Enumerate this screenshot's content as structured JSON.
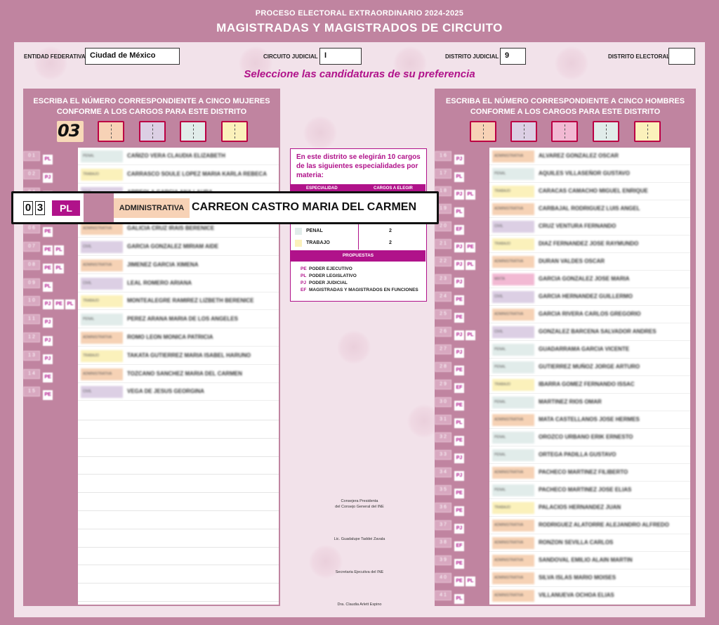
{
  "header": {
    "process": "PROCESO ELECTORAL EXTRAORDINARIO 2024-2025",
    "title": "MAGISTRADAS Y MAGISTRADOS DE CIRCUITO"
  },
  "fields": {
    "entidad_label": "ENTIDAD FEDERATIVA",
    "entidad_value": "Ciudad de México",
    "circuito_label": "CIRCUITO JUDICIAL",
    "circuito_value": "I",
    "distrito_judicial_label": "DISTRITO JUDICIAL",
    "distrito_judicial_value": "9",
    "distrito_electoral_label": "DISTRITO ELECTORAL",
    "distrito_electoral_value": ""
  },
  "instruction": "Seleccione las candidaturas de su preferencia",
  "left_panel": {
    "title_line1": "ESCRIBA EL NÚMERO CORRESPONDIENTE A CINCO MUJERES",
    "title_line2": "CONFORME A LOS CARGOS PARA ESTE DISTRITO",
    "written_slot": "03",
    "candidates": [
      {
        "num": "0 1",
        "tags": [
          "PL"
        ],
        "spec": "PENAL",
        "name": "CAÑIZO VERA CLAUDIA ELIZABETH"
      },
      {
        "num": "0 2",
        "tags": [
          "PJ"
        ],
        "spec": "TRABAJO",
        "name": "CARRASCO SOULE LOPEZ MARIA KARLA REBECA"
      },
      {
        "num": "0 4",
        "tags": [
          "PE"
        ],
        "spec": "CIVIL",
        "name": "ARREOLA GARCIA ANA LAURA"
      },
      {
        "num": "0 5",
        "tags": [
          "PE",
          "PL"
        ],
        "spec": "CIVIL",
        "name": "CONDE NADER SONIA MARIBEL"
      },
      {
        "num": "0 6",
        "tags": [
          "PE"
        ],
        "spec": "ADMINISTRATIVA",
        "name": "GALICIA CRUZ IRAIS BERENICE"
      },
      {
        "num": "0 7",
        "tags": [
          "PE",
          "PL"
        ],
        "spec": "CIVIL",
        "name": "GARCIA GONZALEZ MIRIAM AIDE"
      },
      {
        "num": "0 8",
        "tags": [
          "PE",
          "PL"
        ],
        "spec": "ADMINISTRATIVA",
        "name": "JIMENEZ GARCIA XIMENA"
      },
      {
        "num": "0 9",
        "tags": [
          "PL"
        ],
        "spec": "CIVIL",
        "name": "LEAL ROMERO ARIANA"
      },
      {
        "num": "1 0",
        "tags": [
          "PJ",
          "PE",
          "PL"
        ],
        "spec": "TRABAJO",
        "name": "MONTEALEGRE RAMIREZ LIZBETH BERENICE"
      },
      {
        "num": "1 1",
        "tags": [
          "PJ"
        ],
        "spec": "PENAL",
        "name": "PEREZ ARANA MARIA DE LOS ANGELES"
      },
      {
        "num": "1 2",
        "tags": [
          "PJ"
        ],
        "spec": "ADMINISTRATIVA",
        "name": "ROMO LEON MONICA PATRICIA"
      },
      {
        "num": "1 3",
        "tags": [
          "PJ"
        ],
        "spec": "TRABAJO",
        "name": "TAKATA GUTIERREZ MARIA ISABEL HARUNO"
      },
      {
        "num": "1 4",
        "tags": [
          "PE"
        ],
        "spec": "ADMINISTRATIVA",
        "name": "TOZCANO SANCHEZ MARIA DEL CARMEN"
      },
      {
        "num": "1 5",
        "tags": [
          "PE"
        ],
        "spec": "CIVIL",
        "name": "VEGA DE JESUS GEORGINA"
      }
    ]
  },
  "right_panel": {
    "title_line1": "ESCRIBA EL NÚMERO CORRESPONDIENTE A CINCO HOMBRES",
    "title_line2": "CONFORME A LOS CARGOS PARA ESTE DISTRITO",
    "candidates": [
      {
        "num": "1 6",
        "tags": [
          "PJ"
        ],
        "spec": "ADMINISTRATIVA",
        "name": "ALVAREZ GONZALEZ OSCAR"
      },
      {
        "num": "1 7",
        "tags": [
          "PL"
        ],
        "spec": "PENAL",
        "name": "AQUILES VILLASEÑOR GUSTAVO"
      },
      {
        "num": "1 8",
        "tags": [
          "PJ",
          "PL"
        ],
        "spec": "TRABAJO",
        "name": "CARACAS CAMACHO MIGUEL ENRIQUE"
      },
      {
        "num": "1 9",
        "tags": [
          "PL"
        ],
        "spec": "ADMINISTRATIVA",
        "name": "CARBAJAL RODRIGUEZ LUIS ANGEL"
      },
      {
        "num": "2 0",
        "tags": [
          "EF"
        ],
        "spec": "CIVIL",
        "name": "CRUZ VENTURA FERNANDO"
      },
      {
        "num": "2 1",
        "tags": [
          "PJ",
          "PE"
        ],
        "spec": "TRABAJO",
        "name": "DIAZ FERNANDEZ JOSE RAYMUNDO"
      },
      {
        "num": "2 2",
        "tags": [
          "PJ",
          "PL"
        ],
        "spec": "ADMINISTRATIVA",
        "name": "DURAN VALDES OSCAR"
      },
      {
        "num": "2 3",
        "tags": [
          "PJ"
        ],
        "spec": "MIXTA",
        "name": "GARCIA GONZALEZ JOSE MARIA"
      },
      {
        "num": "2 4",
        "tags": [
          "PE"
        ],
        "spec": "CIVIL",
        "name": "GARCIA HERNANDEZ GUILLERMO"
      },
      {
        "num": "2 5",
        "tags": [
          "PE"
        ],
        "spec": "ADMINISTRATIVA",
        "name": "GARCIA RIVERA CARLOS GREGORIO"
      },
      {
        "num": "2 6",
        "tags": [
          "PJ",
          "PL"
        ],
        "spec": "CIVIL",
        "name": "GONZALEZ BARCENA SALVADOR ANDRES"
      },
      {
        "num": "2 7",
        "tags": [
          "PJ"
        ],
        "spec": "PENAL",
        "name": "GUADARRAMA GARCIA VICENTE"
      },
      {
        "num": "2 8",
        "tags": [
          "PE"
        ],
        "spec": "PENAL",
        "name": "GUTIERREZ MUÑOZ JORGE ARTURO"
      },
      {
        "num": "2 9",
        "tags": [
          "EF"
        ],
        "spec": "TRABAJO",
        "name": "IBARRA GOMEZ FERNANDO ISSAC"
      },
      {
        "num": "3 0",
        "tags": [
          "PE"
        ],
        "spec": "PENAL",
        "name": "MARTINEZ RIOS OMAR"
      },
      {
        "num": "3 1",
        "tags": [
          "PL"
        ],
        "spec": "ADMINISTRATIVA",
        "name": "MATA CASTELLANOS JOSE HERMES"
      },
      {
        "num": "3 2",
        "tags": [
          "PE"
        ],
        "spec": "PENAL",
        "name": "OROZCO URBANO ERIK ERNESTO"
      },
      {
        "num": "3 3",
        "tags": [
          "PJ"
        ],
        "spec": "PENAL",
        "name": "ORTEGA PADILLA GUSTAVO"
      },
      {
        "num": "3 4",
        "tags": [
          "PJ"
        ],
        "spec": "ADMINISTRATIVA",
        "name": "PACHECO MARTINEZ FILIBERTO"
      },
      {
        "num": "3 5",
        "tags": [
          "PE"
        ],
        "spec": "PENAL",
        "name": "PACHECO MARTINEZ JOSE ELIAS"
      },
      {
        "num": "3 6",
        "tags": [
          "PE"
        ],
        "spec": "TRABAJO",
        "name": "PALACIOS HERNANDEZ JUAN"
      },
      {
        "num": "3 7",
        "tags": [
          "PJ"
        ],
        "spec": "ADMINISTRATIVA",
        "name": "RODRIGUEZ ALATORRE ALEJANDRO ALFREDO"
      },
      {
        "num": "3 8",
        "tags": [
          "EF"
        ],
        "spec": "ADMINISTRATIVA",
        "name": "RONZON SEVILLA CARLOS"
      },
      {
        "num": "3 9",
        "tags": [
          "PE"
        ],
        "spec": "ADMINISTRATIVA",
        "name": "SANDOVAL EMILIO ALAIN MARTIN"
      },
      {
        "num": "4 0",
        "tags": [
          "PE",
          "PL"
        ],
        "spec": "ADMINISTRATIVA",
        "name": "SILVA ISLAS MARIO MOISES"
      },
      {
        "num": "4 1",
        "tags": [
          "PL"
        ],
        "spec": "ADMINISTRATIVA",
        "name": "VILLANUEVA OCHOA ELIAS"
      }
    ]
  },
  "info": {
    "intro": "En este distrito se elegirán 10 cargos de las siguientes especialidades por materia:",
    "col_spec": "ESPECIALIDAD",
    "col_count": "CARGOS A ELEGIR",
    "rows": [
      {
        "spec": "PENAL",
        "count": "2",
        "color": "#e1ecea"
      },
      {
        "spec": "TRABAJO",
        "count": "2",
        "color": "#fbf1bb"
      }
    ],
    "proposals_title": "PROPUESTAS",
    "proposals": [
      {
        "abbr": "PE",
        "label": "PODER EJECUTIVO"
      },
      {
        "abbr": "PL",
        "label": "PODER LEGISLATIVO"
      },
      {
        "abbr": "PJ",
        "label": "PODER JUDICIAL"
      },
      {
        "abbr": "EF",
        "label": "MAGISTRADAS Y MAGISTRADOS EN FUNCIONES"
      }
    ]
  },
  "signatures": {
    "pres_title1": "Consejera Presidenta",
    "pres_title2": "del Consejo General del INE",
    "pres_name": "Lic. Guadalupe Taddei Zavala",
    "sec_title": "Secretaria Ejecutiva del INE",
    "sec_name": "Dra. Claudia Arlett Espino"
  },
  "zoomed_row": {
    "digit1": "0",
    "digit2": "3",
    "tag": "PL",
    "spec": "ADMINISTRATIVA",
    "name": "CARREON CASTRO MARIA DEL CARMEN"
  },
  "colors": {
    "frame": "#c084a0",
    "accent": "#b0128a",
    "sheet": "#f2e2ea"
  }
}
